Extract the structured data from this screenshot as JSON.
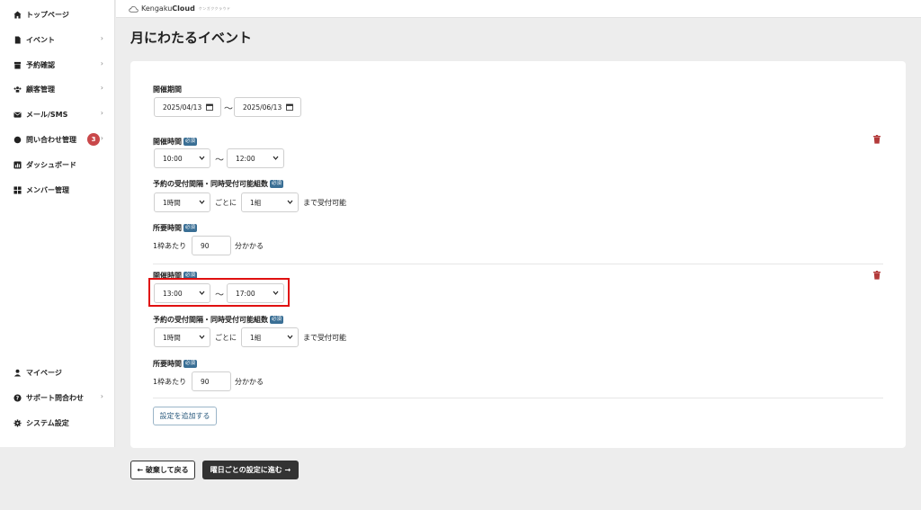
{
  "sidebar": {
    "items": [
      {
        "label": "トップページ",
        "icon": "home-icon"
      },
      {
        "label": "イベント",
        "icon": "document-icon"
      },
      {
        "label": "予約確認",
        "icon": "box-icon"
      },
      {
        "label": "顧客管理",
        "icon": "users-icon"
      },
      {
        "label": "メール/SMS",
        "icon": "mail-icon"
      },
      {
        "label": "問い合わせ管理",
        "icon": "chat-icon",
        "badge": "3"
      },
      {
        "label": "ダッシュボード",
        "icon": "chart-icon"
      },
      {
        "label": "メンバー管理",
        "icon": "grid-icon"
      }
    ],
    "bottom_items": [
      {
        "label": "マイページ",
        "icon": "person-icon"
      },
      {
        "label": "サポート問合わせ",
        "icon": "question-icon"
      },
      {
        "label": "システム設定",
        "icon": "gear-icon"
      }
    ]
  },
  "header": {
    "logo_prefix": "Kengaku",
    "logo_bold": "Cloud",
    "logo_tagline": "ケンガククラウド"
  },
  "page": {
    "title": "月にわたるイベント"
  },
  "form": {
    "period_label": "開催期間",
    "start_date": "2025/04/13",
    "end_date": "2025/06/13",
    "tilde": "〜",
    "required_badge": "必須",
    "blocks": [
      {
        "time_label": "開催時間",
        "start_time": "10:00",
        "end_time": "12:00",
        "interval_label": "予約の受付間隔・同時受付可能組数",
        "interval_value": "1時間",
        "every_text": "ごとに",
        "groups_value": "1組",
        "accept_text": "まで受付可能",
        "duration_label": "所要時間",
        "per_slot_text": "1枠あたり",
        "duration_value": "90",
        "takes_text": "分かかる"
      },
      {
        "time_label": "開催時間",
        "start_time": "13:00",
        "end_time": "17:00",
        "interval_label": "予約の受付間隔・同時受付可能組数",
        "interval_value": "1時間",
        "every_text": "ごとに",
        "groups_value": "1組",
        "accept_text": "まで受付可能",
        "duration_label": "所要時間",
        "per_slot_text": "1枠あたり",
        "duration_value": "90",
        "takes_text": "分かかる"
      }
    ],
    "add_button": "設定を追加する"
  },
  "footer": {
    "back_button": "← 破棄して戻る",
    "next_button": "曜日ごとの設定に進む →"
  },
  "colors": {
    "badge": "#c9484a",
    "required_badge": "#3a6f95",
    "trash": "#b33a3a",
    "highlight": "#e01010",
    "next_button_bg": "#333333"
  }
}
